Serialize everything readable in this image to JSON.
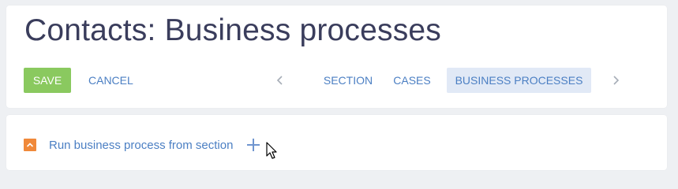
{
  "header": {
    "title": "Contacts: Business processes"
  },
  "toolbar": {
    "save_label": "SAVE",
    "cancel_label": "CANCEL"
  },
  "tabs": [
    {
      "label": "SECTION",
      "active": false
    },
    {
      "label": "CASES",
      "active": false
    },
    {
      "label": "BUSINESS PROCESSES",
      "active": true
    }
  ],
  "tab_nav": {
    "prev_icon": "chevron-left-icon",
    "next_icon": "chevron-right-icon"
  },
  "business_processes": {
    "collapse_icon": "chevron-up-icon",
    "group_label": "Run business process from section",
    "add_icon": "plus-icon"
  },
  "colors": {
    "save_button": "#8ac95f",
    "link": "#4b7fc3",
    "active_tab_bg": "#e1e9f6",
    "collapse_icon_bg": "#f0893a",
    "title": "#3a3d5c",
    "background": "#eef0f3"
  }
}
